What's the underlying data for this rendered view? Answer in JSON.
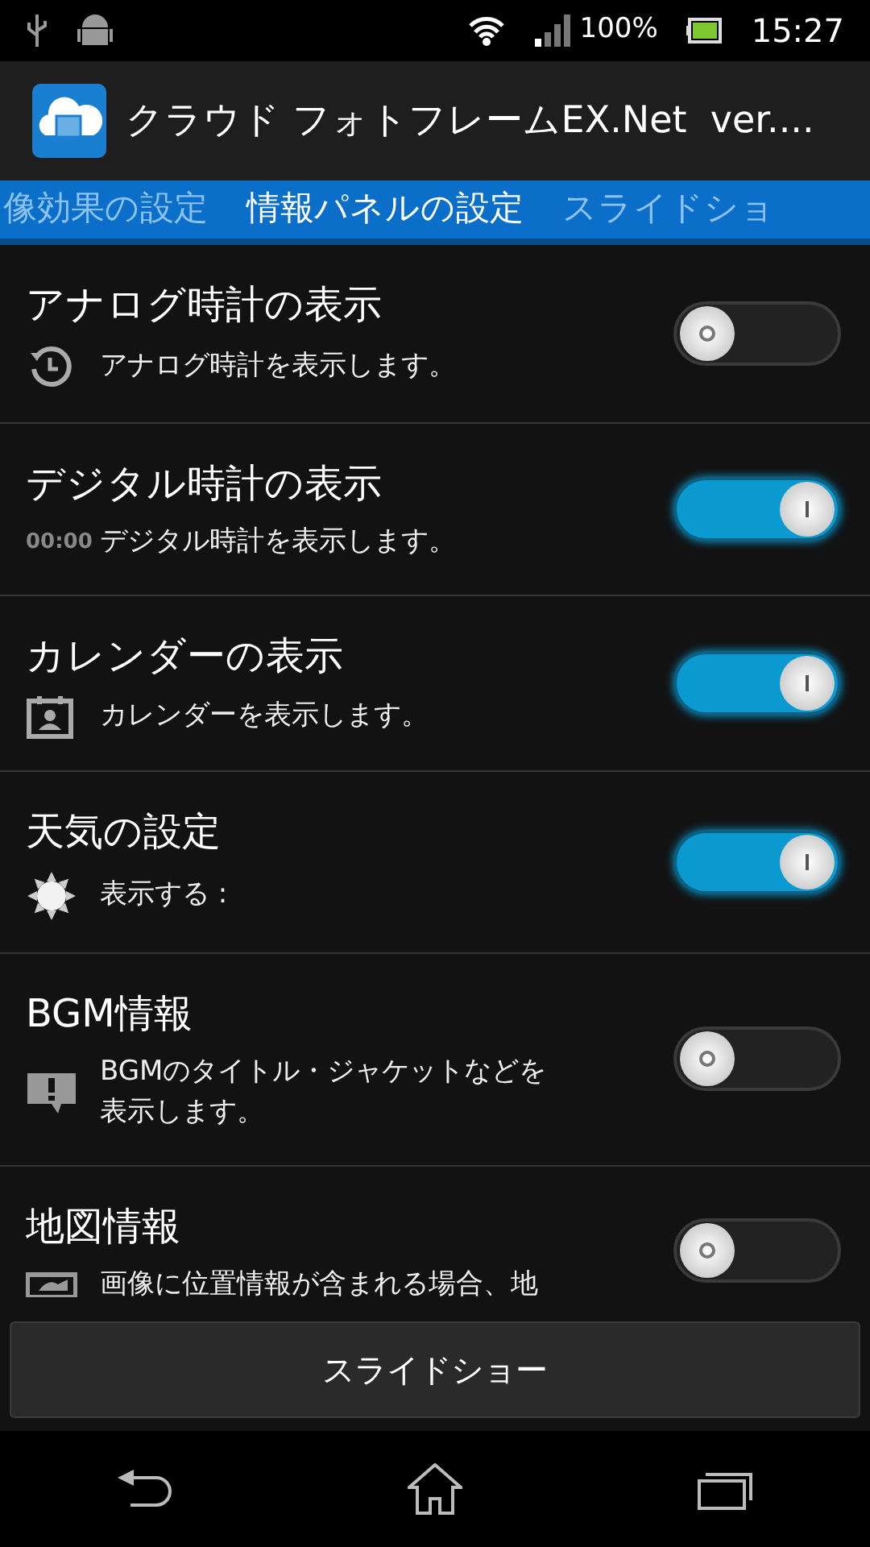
{
  "status_bar": {
    "battery": "100%",
    "time": "15:27"
  },
  "app_bar": {
    "title": "クラウド フォトフレームEX.Net  ver...."
  },
  "tabs": [
    {
      "label": "像効果の設定",
      "selected": false
    },
    {
      "label": "情報パネルの設定",
      "selected": true
    },
    {
      "label": "スライドショ",
      "selected": false
    }
  ],
  "settings": [
    {
      "title": "アナログ時計の表示",
      "summary": "アナログ時計を表示します。",
      "on": false
    },
    {
      "title": "デジタル時計の表示",
      "summary": "デジタル時計を表示します。",
      "icon_text": "00:00",
      "on": true
    },
    {
      "title": "カレンダーの表示",
      "summary": "カレンダーを表示します。",
      "on": true
    },
    {
      "title": "天気の設定",
      "summary": "表示する :",
      "on": true
    },
    {
      "title": "BGM情報",
      "summary": "BGMのタイトル・ジャケットなどを表示します。",
      "on": false
    },
    {
      "title": "地図情報",
      "summary": "画像に位置情報が含まれる場合、地",
      "on": false
    }
  ],
  "bottom_button": {
    "label": "スライドショー"
  }
}
